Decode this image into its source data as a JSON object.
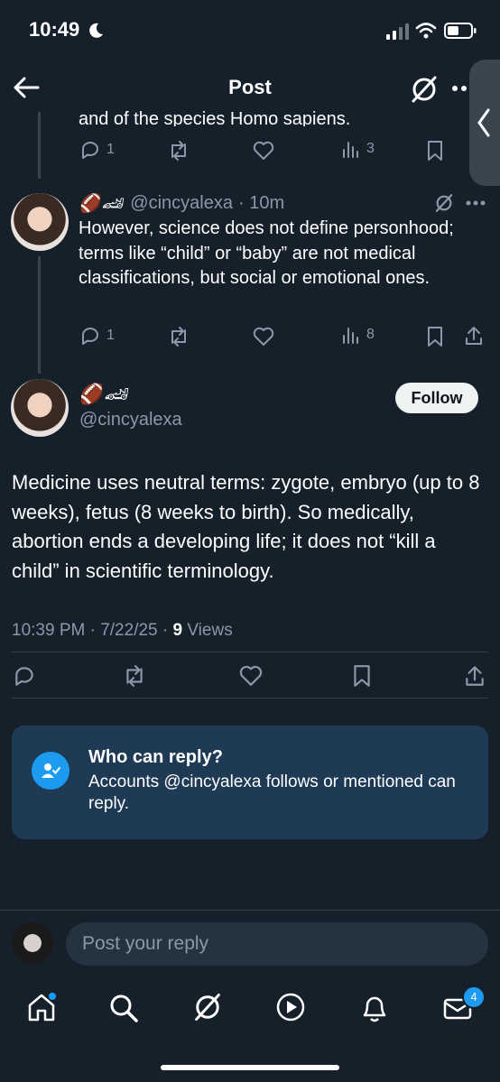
{
  "status_bar": {
    "time": "10:49"
  },
  "header": {
    "title": "Post"
  },
  "thread": {
    "prev_post_tail": "and of the species Homo sapiens.",
    "prev_post_stats": {
      "replies": "1",
      "views": "3"
    },
    "reply": {
      "handle": "@cincyalexa",
      "time": "· 10m",
      "text": "However, science does not define personhood; terms like “child” or “baby” are not medical classifications, but social or emotional ones.",
      "stats": {
        "replies": "1",
        "views": "8"
      }
    }
  },
  "main_post": {
    "name_emoji": "🏈🏎",
    "handle": "@cincyalexa",
    "follow_label": "Follow",
    "text": "Medicine uses neutral terms: zygote, embryo (up to 8 weeks), fetus (8 weeks to birth). So medically, abortion ends a developing life; it does not “kill a child” in scientific terminology.",
    "timestamp": "10:39 PM · 7/22/25 · ",
    "views_count": "9",
    "views_label": " Views"
  },
  "reply_restriction": {
    "title": "Who can reply?",
    "body": "Accounts @cincyalexa follows or mentioned can reply."
  },
  "composer": {
    "placeholder": "Post your reply"
  },
  "bottom_nav": {
    "messages_badge": "4"
  },
  "colors": {
    "background": "#15202b",
    "accent": "#1d9bf0",
    "muted": "#8b98a5",
    "card": "#1e3a55"
  }
}
